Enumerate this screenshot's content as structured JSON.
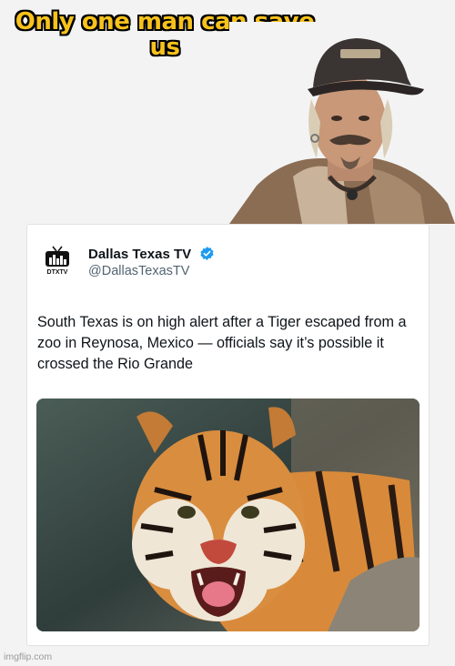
{
  "meme": {
    "caption_line1": "Only one man can save",
    "caption_line2": "us",
    "caption_color": "#f7c21c"
  },
  "tweet": {
    "display_name": "Dallas Texas TV",
    "handle": "@DallasTexasTV",
    "avatar_icon": "tv-logo-icon",
    "avatar_text": "DTXTV",
    "verified_icon": "verified-badge-icon",
    "body": "South Texas is on high alert after a Tiger escaped from a zoo in Reynosa, Mexico — officials say it’s possible it crossed the Rio Grande",
    "image": "tiger-photo"
  },
  "watermark": "imgflip.com",
  "colors": {
    "verified_blue": "#1d9bf0",
    "text_primary": "#0f1419",
    "text_secondary": "#536471"
  }
}
